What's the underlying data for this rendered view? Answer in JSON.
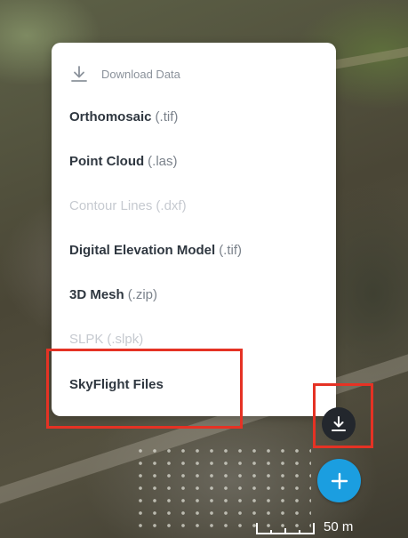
{
  "menu": {
    "header": {
      "icon": "download-icon",
      "label": "Download Data"
    },
    "items": [
      {
        "name": "Orthomosaic",
        "ext": "(.tif)",
        "enabled": true
      },
      {
        "name": "Point Cloud",
        "ext": "(.las)",
        "enabled": true
      },
      {
        "name": "Contour Lines",
        "ext": "(.dxf)",
        "enabled": false
      },
      {
        "name": "Digital Elevation Model",
        "ext": "(.tif)",
        "enabled": true
      },
      {
        "name": "3D Mesh",
        "ext": "(.zip)",
        "enabled": true
      },
      {
        "name": "SLPK",
        "ext": "(.slpk)",
        "enabled": false
      },
      {
        "name": "SkyFlight Files",
        "ext": "",
        "enabled": true
      }
    ]
  },
  "buttons": {
    "download": {
      "icon": "download-icon"
    },
    "add": {
      "icon": "plus-icon"
    }
  },
  "scale": {
    "label": "50 m"
  },
  "colors": {
    "highlight": "#e53224",
    "add_button": "#1b9ee0",
    "download_button": "#23272d",
    "text_primary": "#2f3740",
    "text_disabled": "#c6cad0"
  }
}
